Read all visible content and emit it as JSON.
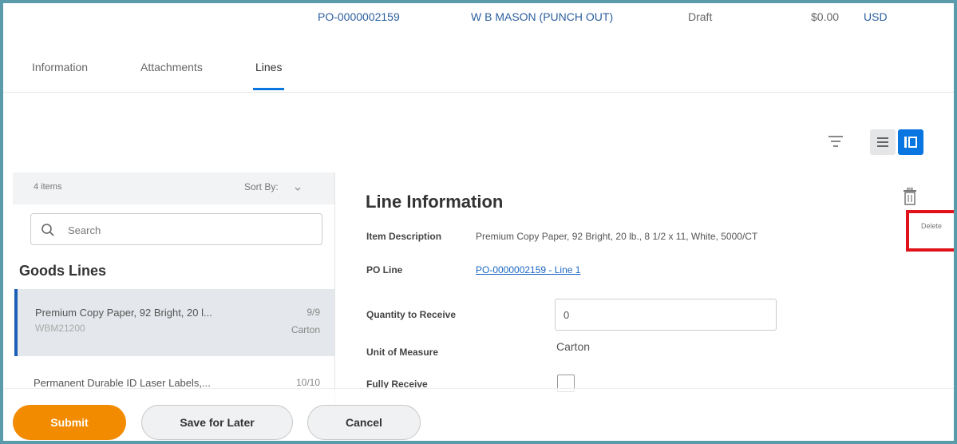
{
  "header": {
    "po_number": "PO-0000002159",
    "supplier": "W B MASON (PUNCH OUT)",
    "status": "Draft",
    "amount": "$0.00",
    "currency": "USD"
  },
  "tabs": [
    {
      "label": "Information"
    },
    {
      "label": "Attachments"
    },
    {
      "label": "Lines",
      "active": true
    }
  ],
  "toolbar": {
    "filter_icon": "filter-icon",
    "view_list_icon": "list-view-icon",
    "view_detail_icon": "detail-view-icon",
    "active_view_color": "#0875e1"
  },
  "left_panel": {
    "items_count": "4 items",
    "sort_by": "Sort By:",
    "search_placeholder": "Search",
    "section_title": "Goods Lines",
    "items": [
      {
        "description": "Premium Copy Paper, 92 Bright, 20 l...",
        "sku": "WBM21200",
        "qty": "9/9",
        "uom": "Carton",
        "selected": true
      },
      {
        "description": "Permanent Durable ID Laser Labels,...",
        "qty": "10/10"
      }
    ]
  },
  "detail": {
    "title": "Line Information",
    "delete_label": "Delete",
    "delete_highlight_color": "#e0121a",
    "item_description_label": "Item Description",
    "item_description_value": "Premium Copy Paper, 92 Bright, 20 lb., 8 1/2 x 11, White, 5000/CT",
    "po_line_label": "PO Line",
    "po_line_value": "PO-0000002159 - Line 1",
    "qty_to_receive_label": "Quantity to Receive",
    "qty_to_receive_value": "0",
    "uom_label": "Unit of Measure",
    "uom_value": "Carton",
    "fully_receive_label": "Fully Receive"
  },
  "actions": {
    "submit": "Submit",
    "save_for_later": "Save for Later",
    "cancel": "Cancel",
    "primary_color": "#f38b00"
  }
}
